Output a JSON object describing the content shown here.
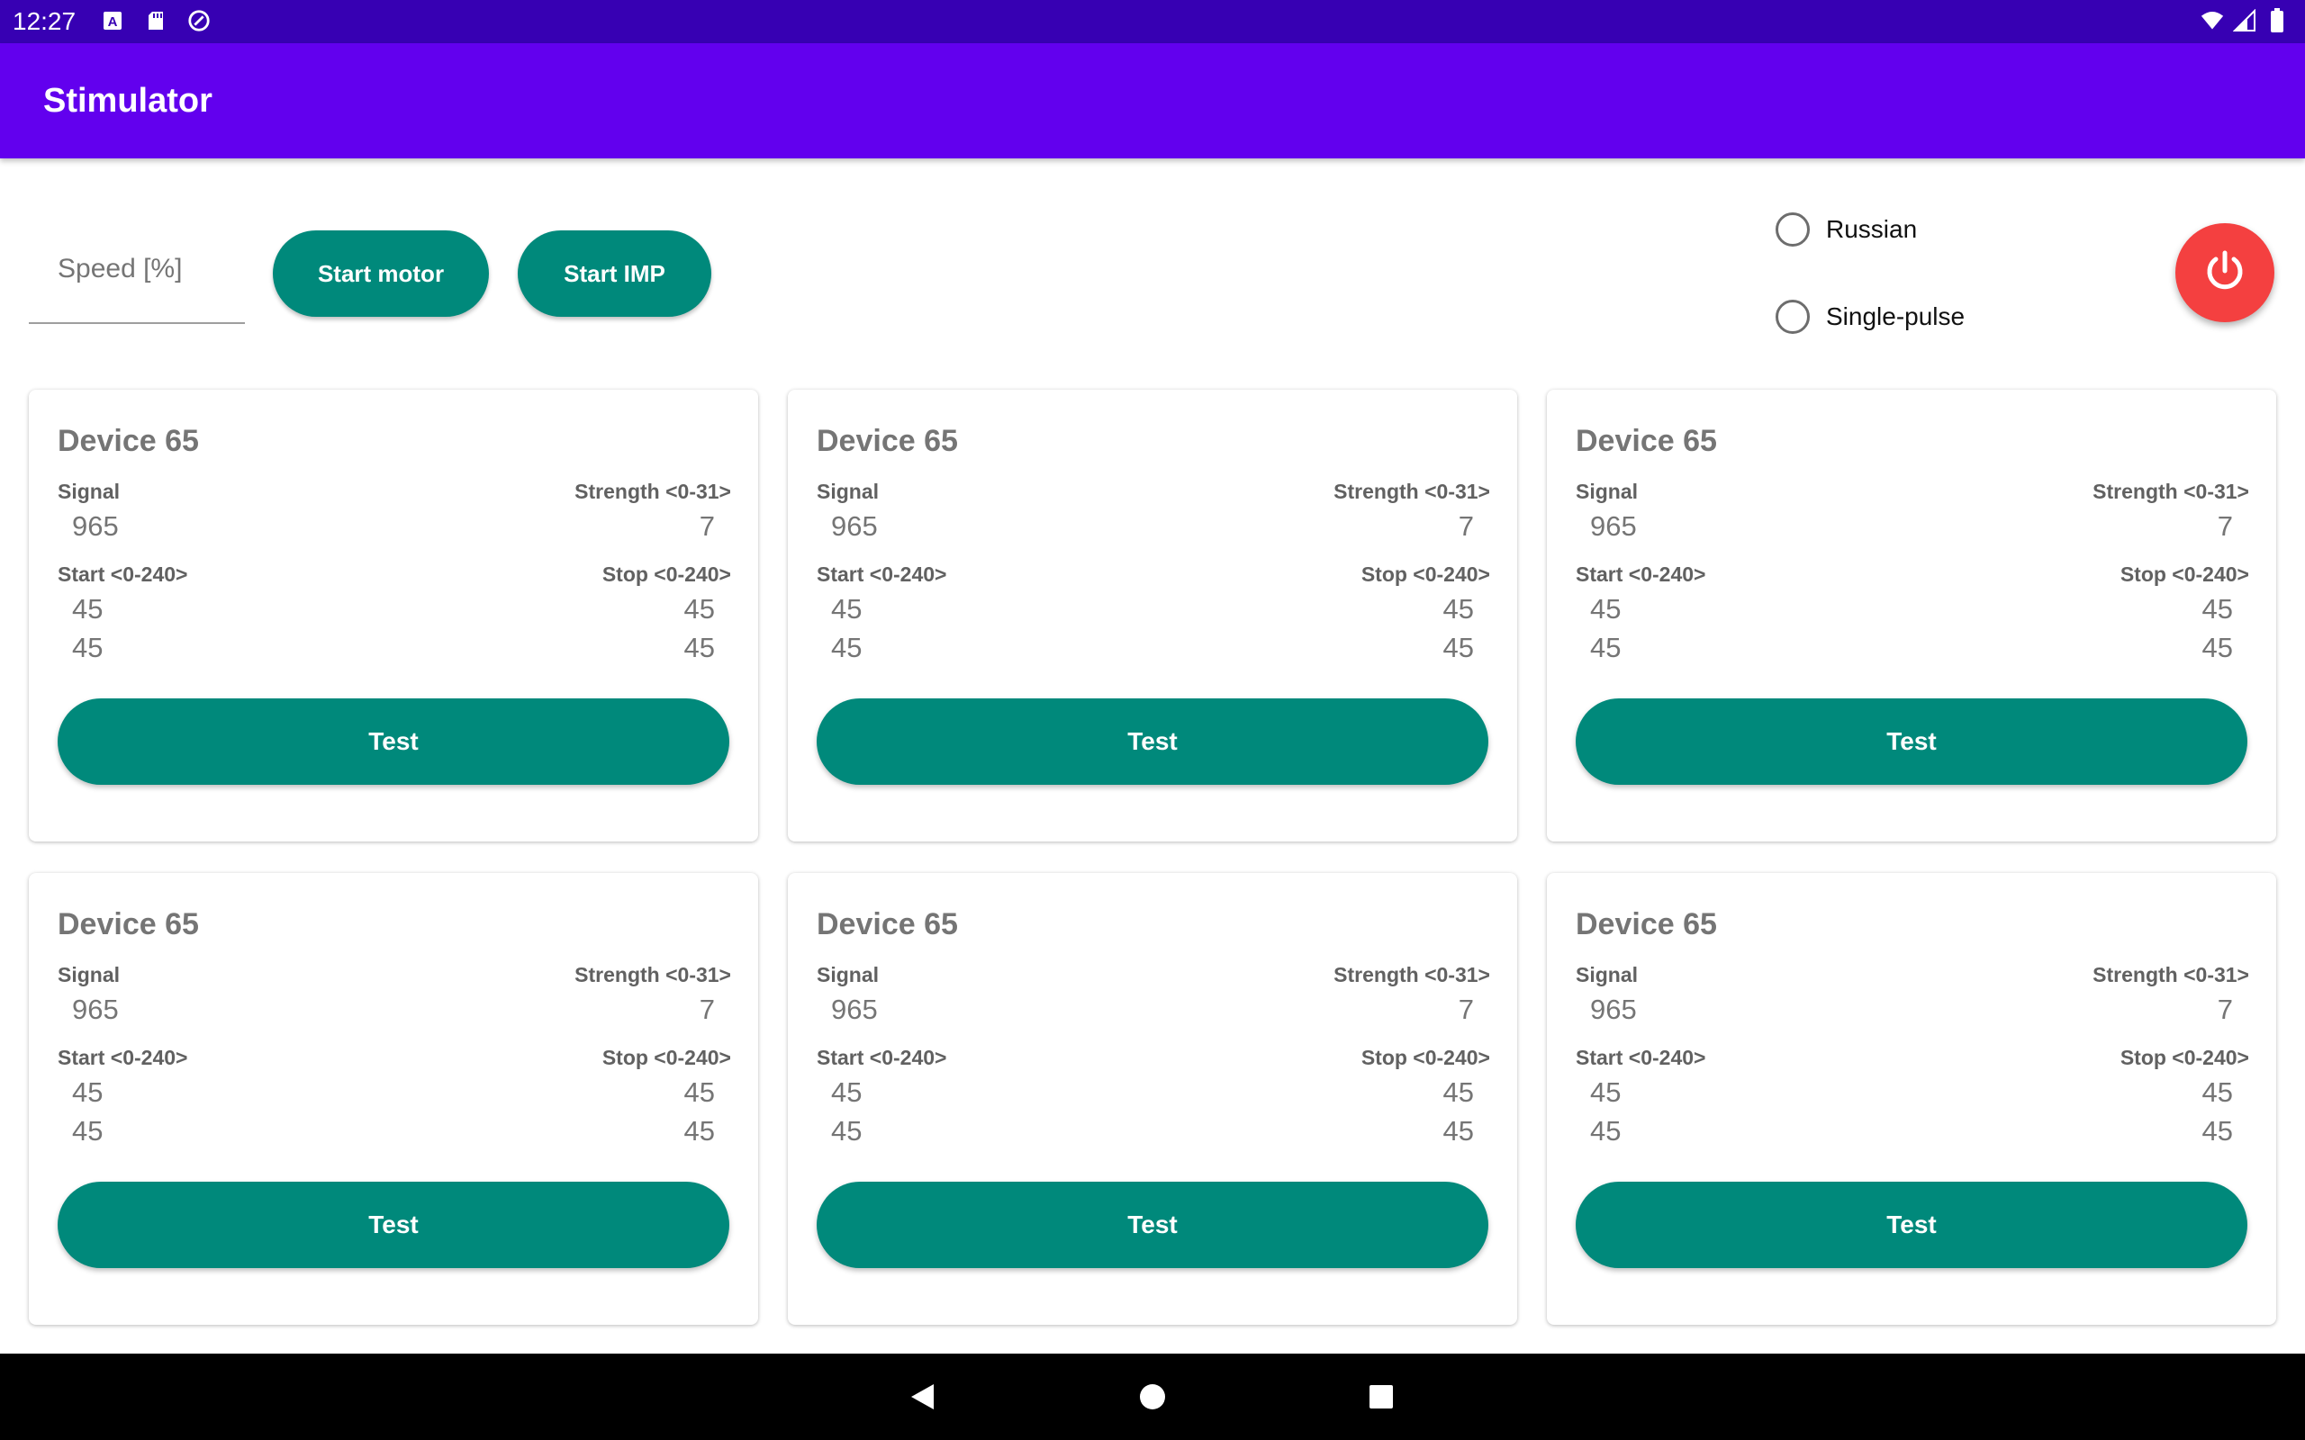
{
  "status_bar": {
    "time": "12:27",
    "icons_left": [
      "a-box-icon",
      "sd-card-icon",
      "data-saver-icon"
    ],
    "icons_right": [
      "wifi-icon",
      "signal-icon",
      "battery-icon"
    ]
  },
  "app_bar": {
    "title": "Stimulator"
  },
  "controls": {
    "speed_placeholder": "Speed [%]",
    "start_motor_label": "Start motor",
    "start_imp_label": "Start IMP",
    "radio_russian_label": "Russian",
    "radio_single_pulse_label": "Single-pulse",
    "power_icon": "power-icon"
  },
  "cards": [
    {
      "title": "Device 65",
      "signal_label": "Signal",
      "signal_value": "965",
      "strength_label": "Strength <0-31>",
      "strength_value": "7",
      "start_label": "Start <0-240>",
      "start_values": [
        "45",
        "45"
      ],
      "stop_label": "Stop <0-240>",
      "stop_values": [
        "45",
        "45"
      ],
      "test_label": "Test"
    },
    {
      "title": "Device 65",
      "signal_label": "Signal",
      "signal_value": "965",
      "strength_label": "Strength <0-31>",
      "strength_value": "7",
      "start_label": "Start <0-240>",
      "start_values": [
        "45",
        "45"
      ],
      "stop_label": "Stop <0-240>",
      "stop_values": [
        "45",
        "45"
      ],
      "test_label": "Test"
    },
    {
      "title": "Device 65",
      "signal_label": "Signal",
      "signal_value": "965",
      "strength_label": "Strength <0-31>",
      "strength_value": "7",
      "start_label": "Start <0-240>",
      "start_values": [
        "45",
        "45"
      ],
      "stop_label": "Stop <0-240>",
      "stop_values": [
        "45",
        "45"
      ],
      "test_label": "Test"
    },
    {
      "title": "Device 65",
      "signal_label": "Signal",
      "signal_value": "965",
      "strength_label": "Strength <0-31>",
      "strength_value": "7",
      "start_label": "Start <0-240>",
      "start_values": [
        "45",
        "45"
      ],
      "stop_label": "Stop <0-240>",
      "stop_values": [
        "45",
        "45"
      ],
      "test_label": "Test"
    },
    {
      "title": "Device 65",
      "signal_label": "Signal",
      "signal_value": "965",
      "strength_label": "Strength <0-31>",
      "strength_value": "7",
      "start_label": "Start <0-240>",
      "start_values": [
        "45",
        "45"
      ],
      "stop_label": "Stop <0-240>",
      "stop_values": [
        "45",
        "45"
      ],
      "test_label": "Test"
    },
    {
      "title": "Device 65",
      "signal_label": "Signal",
      "signal_value": "965",
      "strength_label": "Strength <0-31>",
      "strength_value": "7",
      "start_label": "Start <0-240>",
      "start_values": [
        "45",
        "45"
      ],
      "stop_label": "Stop <0-240>",
      "stop_values": [
        "45",
        "45"
      ],
      "test_label": "Test"
    }
  ],
  "nav_bar": {
    "icons": [
      "back-icon",
      "home-icon",
      "recents-icon"
    ]
  },
  "colors": {
    "status_bar": "#3700b3",
    "app_bar": "#6200ee",
    "accent": "#00897b",
    "power": "#f44040"
  }
}
